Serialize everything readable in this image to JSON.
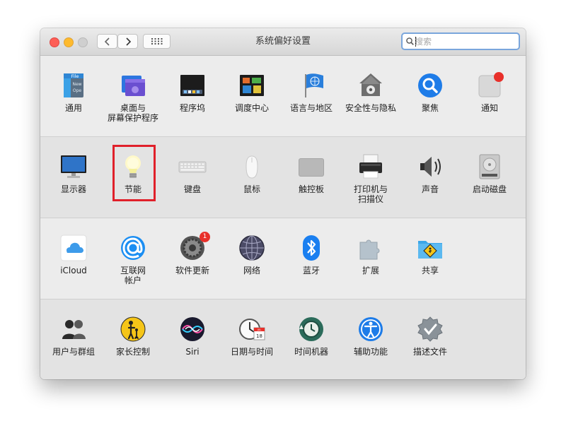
{
  "window": {
    "title": "系统偏好设置"
  },
  "toolbar": {
    "back_label": "<",
    "forward_label": ">",
    "grid_label": "show all"
  },
  "search": {
    "placeholder": "搜索",
    "value": ""
  },
  "rows": [
    {
      "items": [
        {
          "id": "general",
          "label": "通用",
          "icon": "general-icon"
        },
        {
          "id": "desktop",
          "label": "桌面与\n屏幕保护程序",
          "icon": "desktop-screensaver-icon"
        },
        {
          "id": "dock",
          "label": "程序坞",
          "icon": "dock-icon"
        },
        {
          "id": "mission",
          "label": "调度中心",
          "icon": "mission-control-icon"
        },
        {
          "id": "language",
          "label": "语言与地区",
          "icon": "language-region-icon"
        },
        {
          "id": "security",
          "label": "安全性与隐私",
          "icon": "security-privacy-icon"
        },
        {
          "id": "spotlight",
          "label": "聚焦",
          "icon": "spotlight-icon"
        },
        {
          "id": "notifications",
          "label": "通知",
          "icon": "notifications-icon"
        }
      ]
    },
    {
      "items": [
        {
          "id": "displays",
          "label": "显示器",
          "icon": "display-icon"
        },
        {
          "id": "energy",
          "label": "节能",
          "icon": "energy-saver-icon",
          "highlighted": true
        },
        {
          "id": "keyboard",
          "label": "键盘",
          "icon": "keyboard-icon"
        },
        {
          "id": "mouse",
          "label": "鼠标",
          "icon": "mouse-icon"
        },
        {
          "id": "trackpad",
          "label": "触控板",
          "icon": "trackpad-icon"
        },
        {
          "id": "printers",
          "label": "打印机与\n扫描仪",
          "icon": "printer-icon"
        },
        {
          "id": "sound",
          "label": "声音",
          "icon": "sound-icon"
        },
        {
          "id": "startup",
          "label": "启动磁盘",
          "icon": "startup-disk-icon"
        }
      ]
    },
    {
      "items": [
        {
          "id": "icloud",
          "label": "iCloud",
          "icon": "icloud-icon"
        },
        {
          "id": "internet",
          "label": "互联网\n帐户",
          "icon": "internet-accounts-icon"
        },
        {
          "id": "swupdate",
          "label": "软件更新",
          "icon": "software-update-icon",
          "badge": "1"
        },
        {
          "id": "network",
          "label": "网络",
          "icon": "network-icon"
        },
        {
          "id": "bluetooth",
          "label": "蓝牙",
          "icon": "bluetooth-icon"
        },
        {
          "id": "extensions",
          "label": "扩展",
          "icon": "extensions-icon"
        },
        {
          "id": "sharing",
          "label": "共享",
          "icon": "sharing-icon"
        }
      ]
    },
    {
      "items": [
        {
          "id": "users",
          "label": "用户与群组",
          "icon": "users-groups-icon"
        },
        {
          "id": "parental",
          "label": "家长控制",
          "icon": "parental-controls-icon"
        },
        {
          "id": "siri",
          "label": "Siri",
          "icon": "siri-icon"
        },
        {
          "id": "datetime",
          "label": "日期与时间",
          "icon": "date-time-icon"
        },
        {
          "id": "timemachine",
          "label": "时间机器",
          "icon": "time-machine-icon"
        },
        {
          "id": "accessibility",
          "label": "辅助功能",
          "icon": "accessibility-icon"
        },
        {
          "id": "profiles",
          "label": "描述文件",
          "icon": "profiles-icon"
        }
      ]
    }
  ],
  "icon_texts": {
    "general_file": "File",
    "general_new": "New",
    "general_open": "Ope",
    "calendar_month": "JUL",
    "calendar_day": "18"
  },
  "colors": {
    "highlight": "#e0202a",
    "search_focus": "#7aa6dc",
    "badge": "#e8302a"
  }
}
